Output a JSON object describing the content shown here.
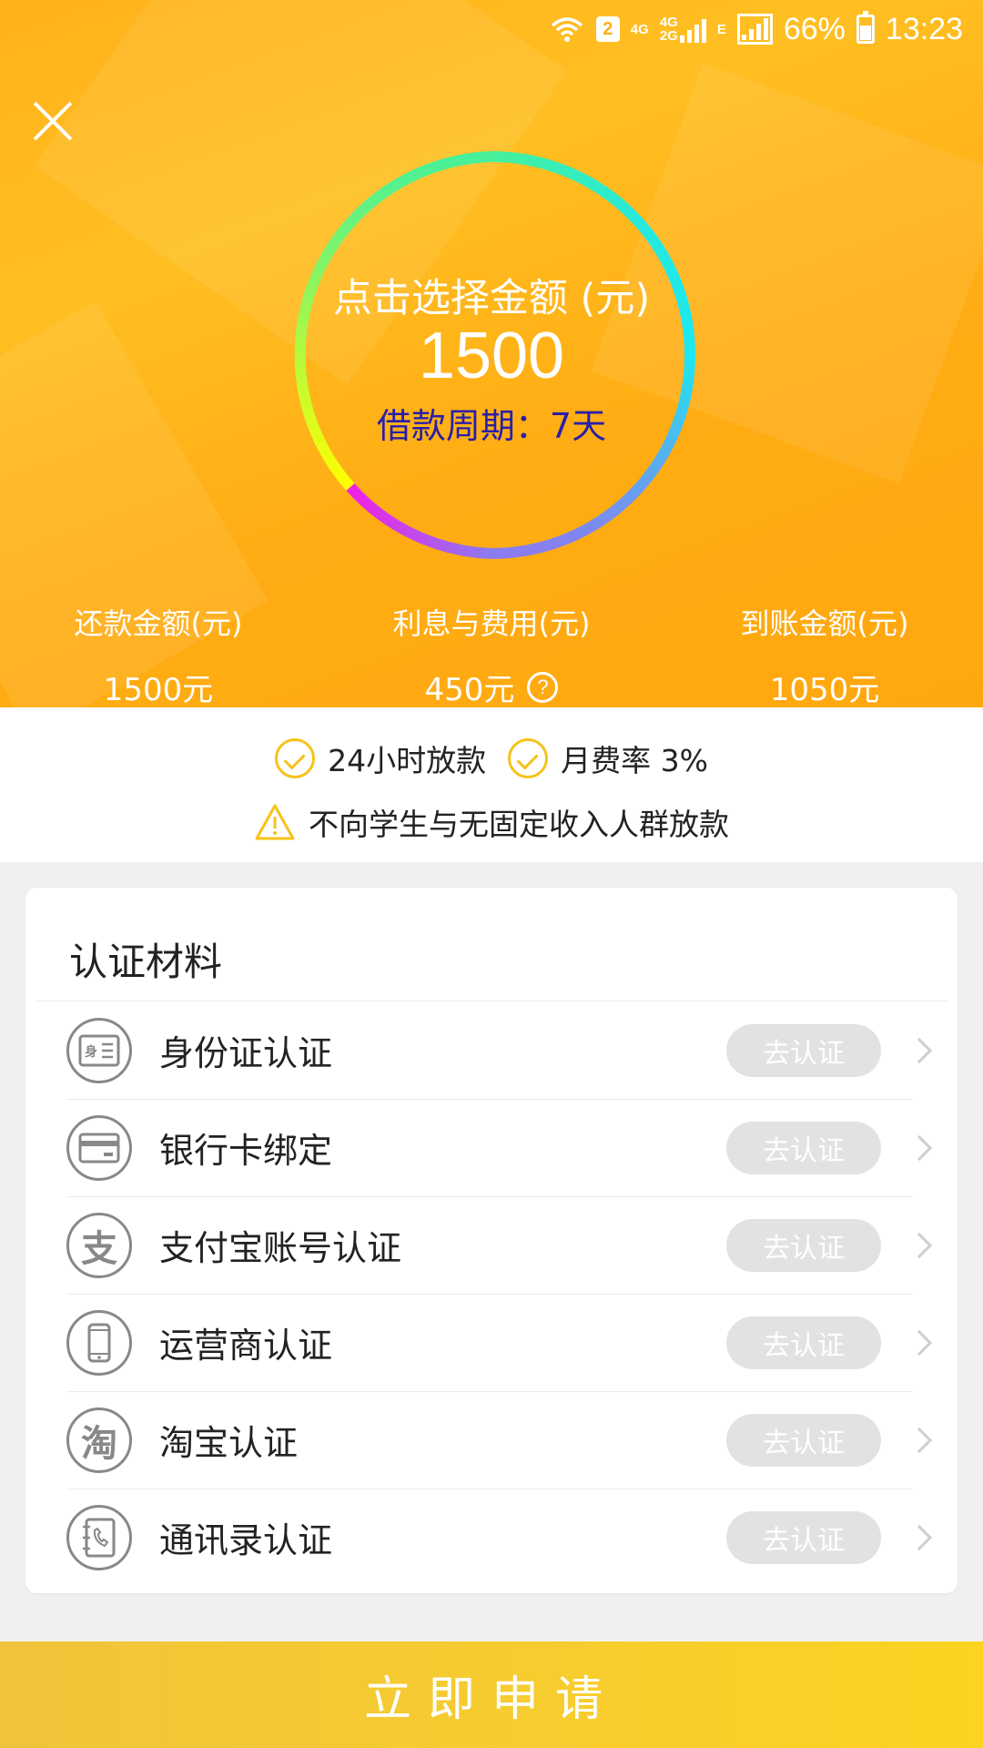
{
  "status_bar": {
    "sim_slot": "2",
    "net_top": "4G",
    "net_dual_top": "4G",
    "net_dual_bottom": "2G",
    "net_e": "E",
    "battery": "66%",
    "time": "13:23"
  },
  "ring": {
    "label": "点击选择金额 (元)",
    "amount": "1500",
    "period": "借款周期：7天"
  },
  "summary": {
    "repay_label": "还款金额(元)",
    "repay_value": "1500元",
    "interest_label": "利息与费用(元)",
    "interest_value": "450元",
    "arrival_label": "到账金额(元)",
    "arrival_value": "1050元"
  },
  "features": {
    "item1": "24小时放款",
    "item2": "月费率 3%",
    "warning": "不向学生与无固定收入人群放款"
  },
  "certification": {
    "title": "认证材料",
    "items": [
      {
        "label": "身份证认证",
        "button": "去认证",
        "icon": "id-card-icon"
      },
      {
        "label": "银行卡绑定",
        "button": "去认证",
        "icon": "bank-card-icon"
      },
      {
        "label": "支付宝账号认证",
        "button": "去认证",
        "icon": "alipay-icon"
      },
      {
        "label": "运营商认证",
        "button": "去认证",
        "icon": "phone-icon"
      },
      {
        "label": "淘宝认证",
        "button": "去认证",
        "icon": "taobao-icon"
      },
      {
        "label": "通讯录认证",
        "button": "去认证",
        "icon": "contacts-icon"
      }
    ]
  },
  "apply_label": "立即申请",
  "colors": {
    "header_orange": "#ffb21a",
    "period_text": "#2a1fa8",
    "check_yellow": "#f7c21a",
    "apply_yellow": "#f7cc2f"
  }
}
